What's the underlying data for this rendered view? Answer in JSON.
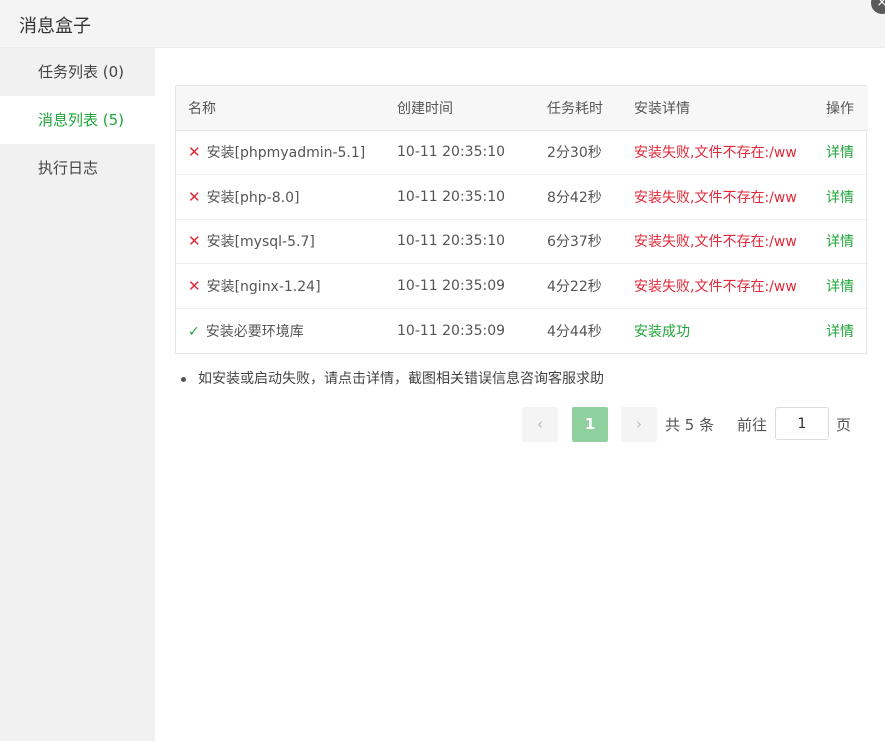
{
  "window": {
    "title": "消息盒子",
    "close_icon": "×"
  },
  "sidebar": {
    "items": [
      {
        "label": "任务列表 (0)",
        "active": false
      },
      {
        "label": "消息列表 (5)",
        "active": true
      },
      {
        "label": "执行日志",
        "active": false
      }
    ]
  },
  "table": {
    "headers": [
      "名称",
      "创建时间",
      "任务耗时",
      "安装详情",
      "操作"
    ],
    "rows": [
      {
        "status": "fail",
        "icon": "✕",
        "name": "安装[phpmyadmin-5.1]",
        "created": "10-11 20:35:10",
        "duration": "2分30秒",
        "detail": "安装失败,文件不存在:/ww",
        "action": "详情"
      },
      {
        "status": "fail",
        "icon": "✕",
        "name": "安装[php-8.0]",
        "created": "10-11 20:35:10",
        "duration": "8分42秒",
        "detail": "安装失败,文件不存在:/ww",
        "action": "详情"
      },
      {
        "status": "fail",
        "icon": "✕",
        "name": "安装[mysql-5.7]",
        "created": "10-11 20:35:10",
        "duration": "6分37秒",
        "detail": "安装失败,文件不存在:/ww",
        "action": "详情"
      },
      {
        "status": "fail",
        "icon": "✕",
        "name": "安装[nginx-1.24]",
        "created": "10-11 20:35:09",
        "duration": "4分22秒",
        "detail": "安装失败,文件不存在:/ww",
        "action": "详情"
      },
      {
        "status": "ok",
        "icon": "✓",
        "name": "安装必要环境库",
        "created": "10-11 20:35:09",
        "duration": "4分44秒",
        "detail": "安装成功",
        "action": "详情"
      }
    ]
  },
  "tip": "如安装或启动失败，请点击详情，截图相关错误信息咨询客服求助",
  "pagination": {
    "prev_icon": "‹",
    "current": "1",
    "next_icon": "›",
    "total": "共 5 条",
    "goto_label": "前往",
    "goto_value": "1",
    "page_unit": "页"
  },
  "colors": {
    "accent": "#20a53a",
    "error": "#e0293a",
    "active_page": "#8fd19e"
  }
}
